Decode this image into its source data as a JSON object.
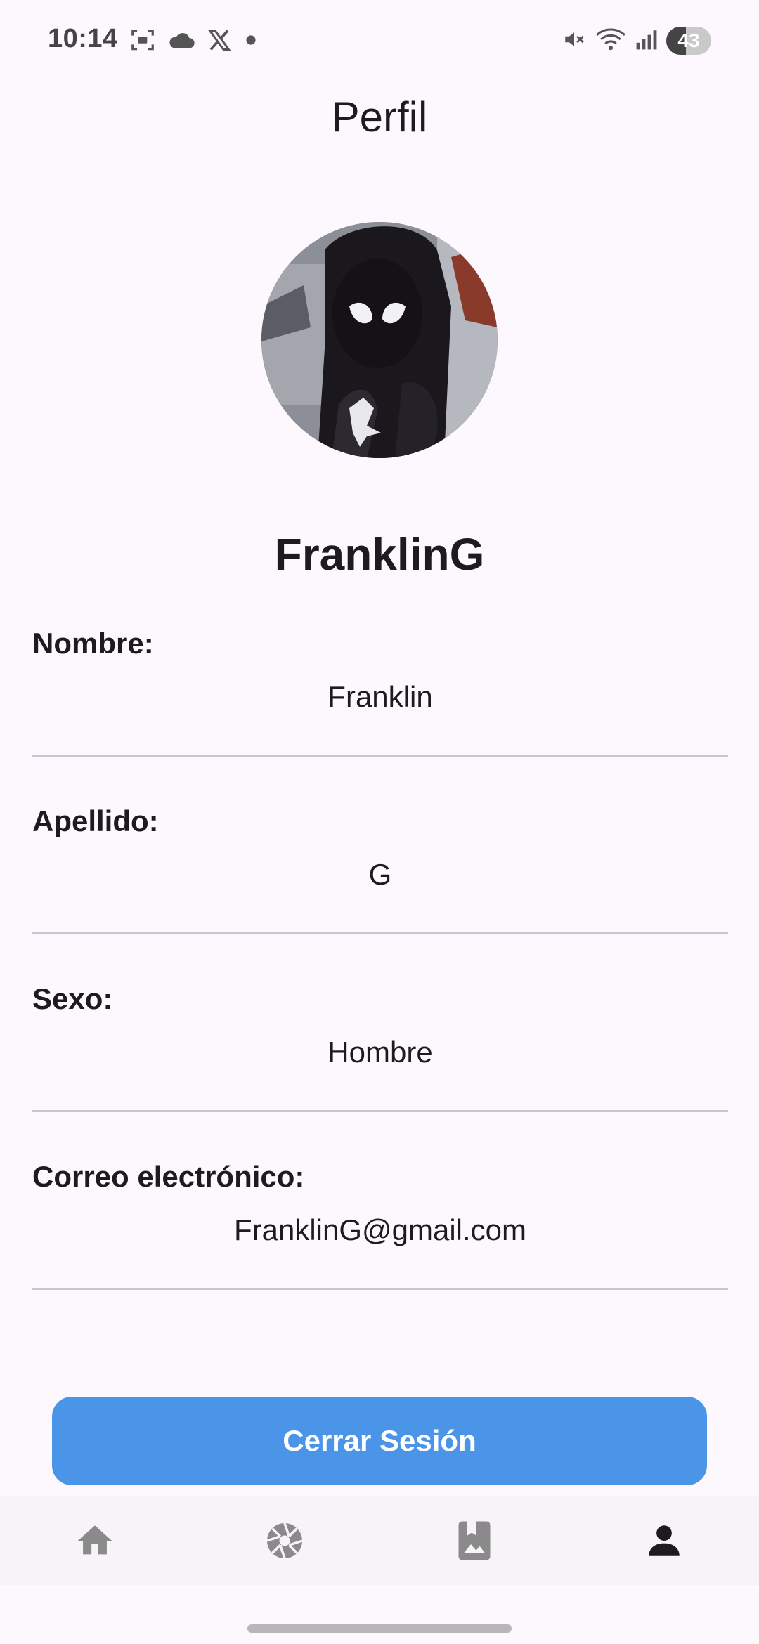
{
  "status_bar": {
    "time": "10:14",
    "battery_level": "43",
    "battery_fraction": 0.43,
    "left_icons": [
      "screenshot-icon",
      "cloud-icon",
      "x-logo-icon",
      "notification-dot-icon"
    ],
    "right_icons": [
      "vibrate-mute-icon",
      "wifi-icon",
      "signal-icon",
      "battery-icon"
    ]
  },
  "header": {
    "title": "Perfil"
  },
  "profile": {
    "username": "FranklinG",
    "avatar_icon": "avatar-image"
  },
  "fields": [
    {
      "label": "Nombre:",
      "value": "Franklin"
    },
    {
      "label": "Apellido:",
      "value": "G"
    },
    {
      "label": "Sexo:",
      "value": "Hombre"
    },
    {
      "label": "Correo electrónico:",
      "value": "FranklinG@gmail.com"
    }
  ],
  "logout": {
    "label": "Cerrar Sesión",
    "color": "#4b95e9"
  },
  "bottom_nav": {
    "items": [
      {
        "icon": "home-icon",
        "active": false
      },
      {
        "icon": "camera-shutter-icon",
        "active": false
      },
      {
        "icon": "photo-bookmark-icon",
        "active": false
      },
      {
        "icon": "person-icon",
        "active": true
      }
    ],
    "inactive_color": "#8a8a8a",
    "active_color": "#1d1b20"
  }
}
